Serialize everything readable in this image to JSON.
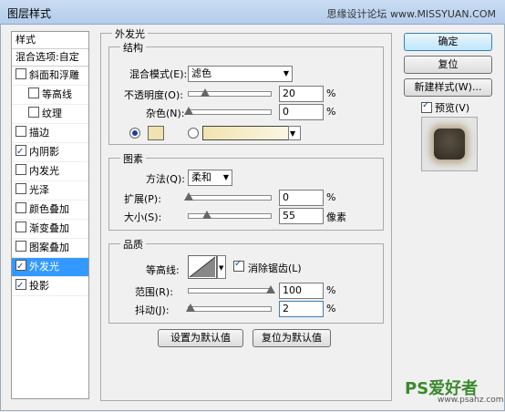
{
  "window": {
    "title": "图层样式",
    "watermark": "思缘设计论坛 www.MISSYUAN.COM",
    "close": "✕"
  },
  "left": {
    "header": "样式",
    "blend_options": "混合选项:自定",
    "items": [
      {
        "label": "斜面和浮雕",
        "checked": false,
        "indent": false
      },
      {
        "label": "等高线",
        "checked": false,
        "indent": true
      },
      {
        "label": "纹理",
        "checked": false,
        "indent": true
      },
      {
        "label": "描边",
        "checked": false,
        "indent": false
      },
      {
        "label": "内阴影",
        "checked": true,
        "indent": false
      },
      {
        "label": "内发光",
        "checked": false,
        "indent": false
      },
      {
        "label": "光泽",
        "checked": false,
        "indent": false
      },
      {
        "label": "颜色叠加",
        "checked": false,
        "indent": false
      },
      {
        "label": "渐变叠加",
        "checked": false,
        "indent": false
      },
      {
        "label": "图案叠加",
        "checked": false,
        "indent": false
      },
      {
        "label": "外发光",
        "checked": true,
        "indent": false,
        "selected": true
      },
      {
        "label": "投影",
        "checked": true,
        "indent": false
      }
    ]
  },
  "main": {
    "group_title": "外发光",
    "structure": {
      "title": "结构",
      "blend_mode_label": "混合模式(E):",
      "blend_mode": "滤色",
      "opacity_label": "不透明度(O):",
      "opacity": "20",
      "opacity_value": 20,
      "noise_label": "杂色(N):",
      "noise": "0",
      "noise_value": 0,
      "percent": "%",
      "color_swatch": "#f1e3b0"
    },
    "elements": {
      "title": "图素",
      "method_label": "方法(Q):",
      "method": "柔和",
      "spread_label": "扩展(P):",
      "spread": "0",
      "spread_value": 0,
      "size_label": "大小(S):",
      "size": "55",
      "size_value": 55,
      "size_unit": "像素",
      "percent": "%"
    },
    "quality": {
      "title": "品质",
      "contour_label": "等高线:",
      "antialias_label": "消除锯齿(L)",
      "antialias_checked": true,
      "range_label": "范围(R):",
      "range": "100",
      "range_value": 100,
      "jitter_label": "抖动(J):",
      "jitter": "2",
      "jitter_value": 2,
      "percent": "%"
    },
    "set_default": "设置为默认值",
    "reset_default": "复位为默认值"
  },
  "right": {
    "ok": "确定",
    "reset": "复位",
    "new_style": "新建样式(W)...",
    "preview_label": "预览(V)",
    "preview_checked": true
  },
  "footer_watermark": {
    "brand": "PS爱好者",
    "url": "www.psahz.com"
  }
}
